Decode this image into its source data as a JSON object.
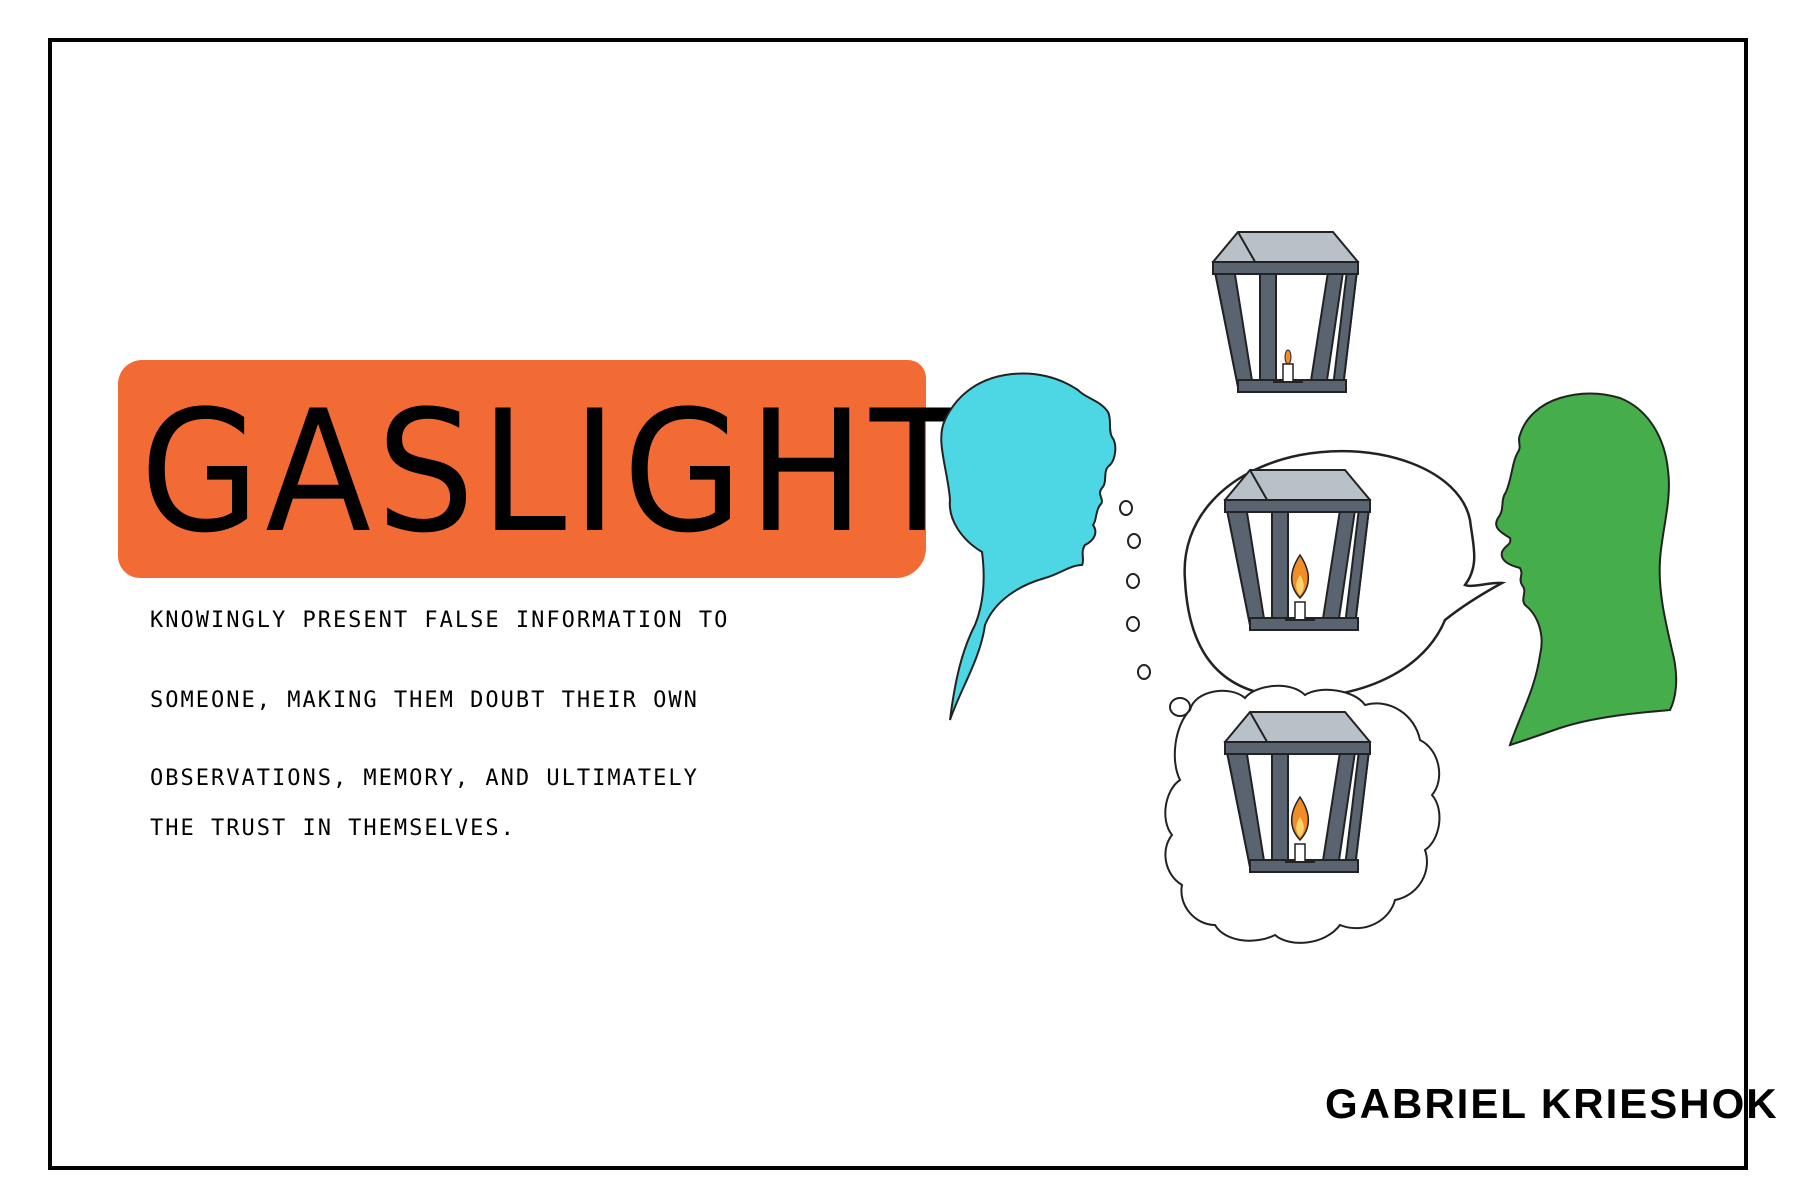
{
  "title": "GASLIGHT",
  "definition": {
    "lines": [
      "KNOWINGLY PRESENT FALSE INFORMATION TO",
      "SOMEONE, MAKING THEM DOUBT THEIR OWN",
      "OBSERVATIONS, MEMORY, AND ULTIMATELY",
      "THE TRUST IN THEMSELVES."
    ]
  },
  "signature": "GABRIEL KRIESHOK",
  "colors": {
    "title_band": "#f26b35",
    "woman_silhouette": "#4dd6e4",
    "man_silhouette": "#45ad4a",
    "lantern_frame": "#5a6470",
    "lantern_roof": "#b9c1c8",
    "flame": "#f28c28"
  },
  "illustration": {
    "woman": "woman-silhouette",
    "man": "man-silhouette",
    "lanterns": [
      "lantern-top-dim",
      "lantern-speech-bright",
      "lantern-thought-bright"
    ]
  }
}
